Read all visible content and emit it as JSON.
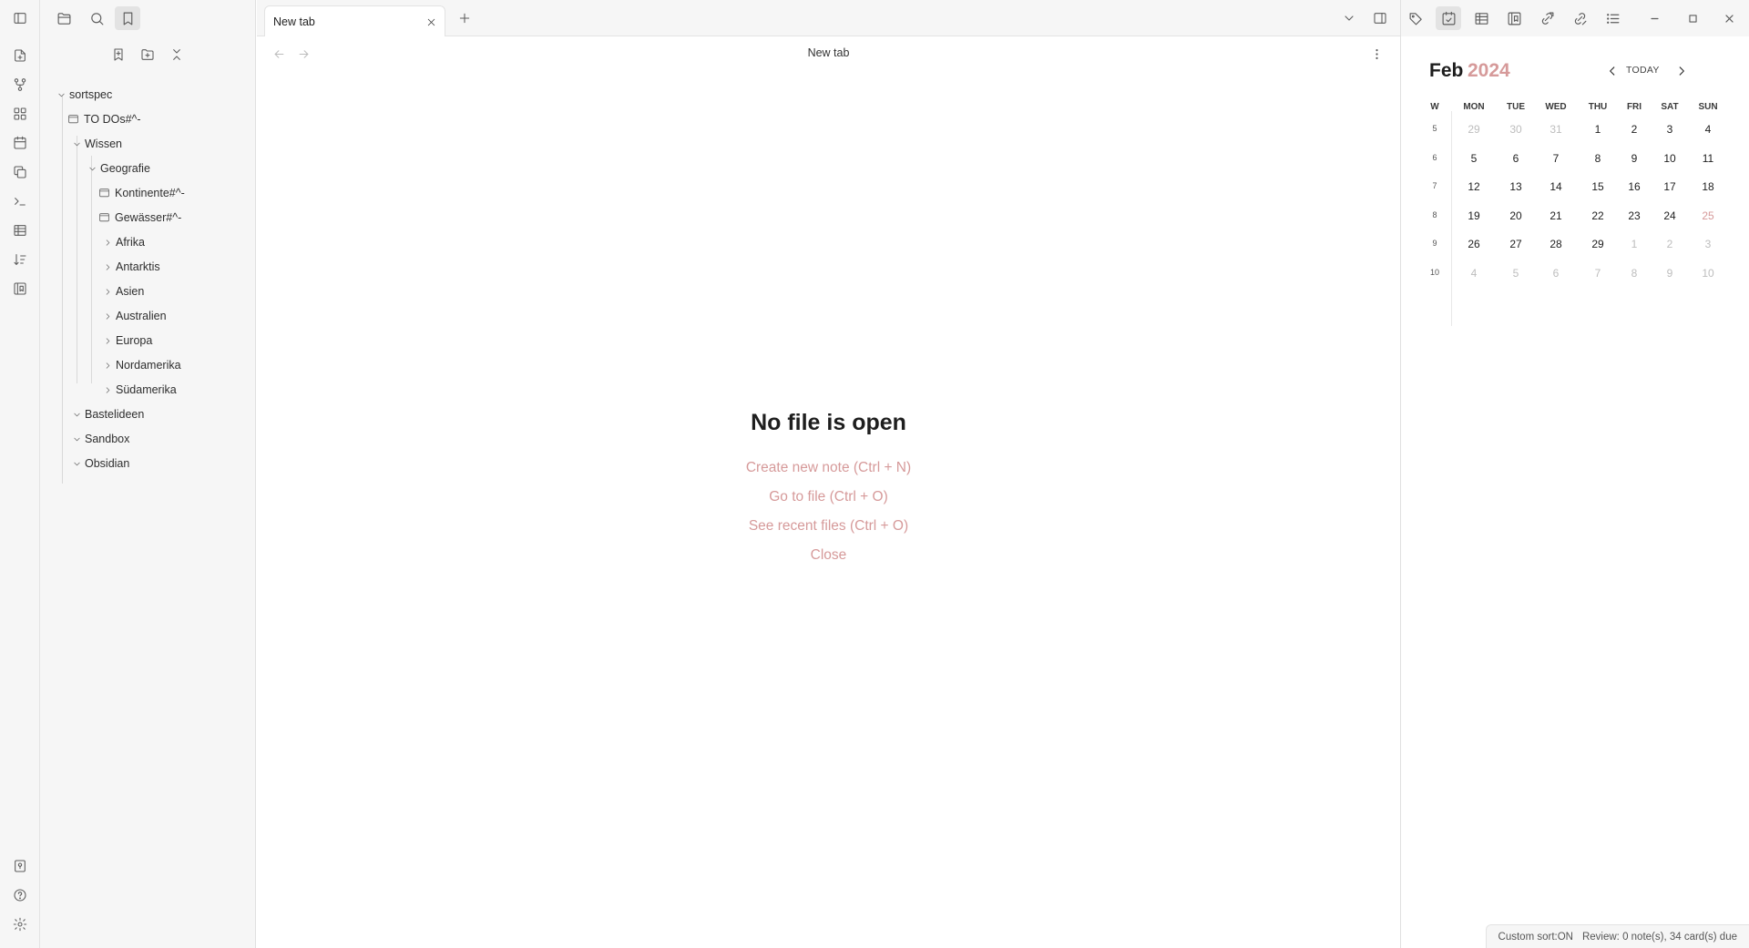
{
  "ribbon": {
    "top_icons": [
      "file-plus-icon",
      "git-fork-icon",
      "grid-icon",
      "calendar-icon",
      "copy-icon",
      "terminal-icon",
      "table-icon",
      "sort-icon",
      "bookmark-sidebar-icon"
    ],
    "bottom_icons": [
      "vault-icon",
      "help-icon",
      "settings-icon"
    ]
  },
  "left_sidebar": {
    "top_icons": [
      "sidebar-toggle-icon",
      "folder-icon",
      "search-icon",
      "bookmark-icon"
    ],
    "nav_icons": [
      "new-bookmark-icon",
      "new-folder-icon",
      "collapse-all-icon"
    ],
    "tree": [
      {
        "label": "sortspec",
        "type": "folder",
        "expanded": true
      },
      {
        "label": "TO DOs#^-",
        "type": "file"
      },
      {
        "label": "Wissen",
        "type": "folder",
        "expanded": true
      },
      {
        "label": "Geografie",
        "type": "folder",
        "expanded": true
      },
      {
        "label": "Kontinente#^-",
        "type": "file"
      },
      {
        "label": "Gewässer#^-",
        "type": "file"
      },
      {
        "label": "Afrika",
        "type": "folder",
        "expanded": false
      },
      {
        "label": "Antarktis",
        "type": "folder",
        "expanded": false
      },
      {
        "label": "Asien",
        "type": "folder",
        "expanded": false
      },
      {
        "label": "Australien",
        "type": "folder",
        "expanded": false
      },
      {
        "label": "Europa",
        "type": "folder",
        "expanded": false
      },
      {
        "label": "Nordamerika",
        "type": "folder",
        "expanded": false
      },
      {
        "label": "Südamerika",
        "type": "folder",
        "expanded": false
      },
      {
        "label": "Bastelideen",
        "type": "folder",
        "expanded": true
      },
      {
        "label": "Sandbox",
        "type": "folder",
        "expanded": true
      },
      {
        "label": "Obsidian",
        "type": "folder",
        "expanded": true
      }
    ]
  },
  "tabs": {
    "active_tab_label": "New tab"
  },
  "view": {
    "title": "New tab"
  },
  "empty_state": {
    "title": "No file is open",
    "create_note": "Create new note (Ctrl + N)",
    "go_to_file": "Go to file (Ctrl + O)",
    "recent_files": "See recent files (Ctrl + O)",
    "close": "Close"
  },
  "right_sidebar": {
    "header_icons": [
      "tags-icon",
      "calendar-check-icon",
      "table-icon",
      "bookmark-sidebar-icon",
      "outgoing-links-icon",
      "backlinks-icon",
      "list-icon"
    ],
    "active_icon": "calendar-check-icon"
  },
  "window_controls": [
    "minimize-icon",
    "maximize-icon",
    "close-icon"
  ],
  "calendar": {
    "month": "Feb",
    "year": "2024",
    "today_label": "TODAY",
    "headers": [
      "W",
      "MON",
      "TUE",
      "WED",
      "THU",
      "FRI",
      "SAT",
      "SUN"
    ],
    "weeks": [
      {
        "week": "5",
        "days": [
          "29",
          "30",
          "31",
          "1",
          "2",
          "3",
          "4"
        ],
        "dim": [
          true,
          true,
          true,
          false,
          false,
          false,
          false
        ]
      },
      {
        "week": "6",
        "days": [
          "5",
          "6",
          "7",
          "8",
          "9",
          "10",
          "11"
        ],
        "dim": [
          false,
          false,
          false,
          false,
          false,
          false,
          false
        ]
      },
      {
        "week": "7",
        "days": [
          "12",
          "13",
          "14",
          "15",
          "16",
          "17",
          "18"
        ],
        "dim": [
          false,
          false,
          false,
          false,
          false,
          false,
          false
        ]
      },
      {
        "week": "8",
        "days": [
          "19",
          "20",
          "21",
          "22",
          "23",
          "24",
          "25"
        ],
        "dim": [
          false,
          false,
          false,
          false,
          false,
          false,
          false
        ]
      },
      {
        "week": "9",
        "days": [
          "26",
          "27",
          "28",
          "29",
          "1",
          "2",
          "3"
        ],
        "dim": [
          false,
          false,
          false,
          false,
          true,
          true,
          true
        ]
      },
      {
        "week": "10",
        "days": [
          "4",
          "5",
          "6",
          "7",
          "8",
          "9",
          "10"
        ],
        "dim": [
          true,
          true,
          true,
          true,
          true,
          true,
          true
        ]
      }
    ],
    "today": "25",
    "colors": {
      "accent": "#d69a9a"
    }
  },
  "status_bar": {
    "sort": "Custom sort:ON",
    "review": "Review: 0 note(s), 34 card(s) due"
  },
  "colors": {
    "sidebar_bg": "#f6f6f6",
    "accent": "#d69a9a",
    "text": "#222222"
  }
}
